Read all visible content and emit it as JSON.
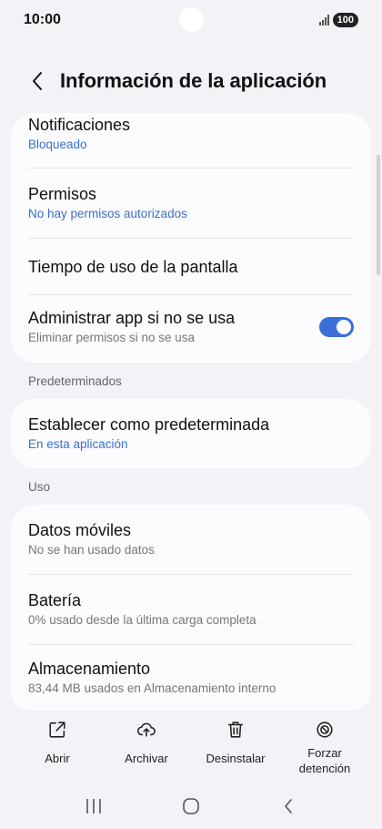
{
  "status": {
    "time": "10:00",
    "battery": "100"
  },
  "header": {
    "title": "Información de la aplicación"
  },
  "card1": {
    "items": [
      {
        "title": "Notificaciones",
        "sub": "Bloqueado"
      },
      {
        "title": "Permisos",
        "sub": "No hay permisos autorizados"
      },
      {
        "title": "Tiempo de uso de la pantalla"
      },
      {
        "title": "Administrar app si no se usa",
        "sub": "Eliminar permisos si no se usa",
        "toggle_on": true
      }
    ]
  },
  "section_defaults": {
    "label": "Predeterminados"
  },
  "card2": {
    "items": [
      {
        "title": "Establecer como predeterminada",
        "sub": "En esta aplicación"
      }
    ]
  },
  "section_usage": {
    "label": "Uso"
  },
  "card3": {
    "items": [
      {
        "title": "Datos móviles",
        "sub": "No se han usado datos"
      },
      {
        "title": "Batería",
        "sub": "0% usado desde la última carga completa"
      },
      {
        "title": "Almacenamiento",
        "sub": "83,44 MB usados en Almacenamiento interno"
      }
    ]
  },
  "actions": [
    {
      "label": "Abrir",
      "icon": "open-external-icon"
    },
    {
      "label": "Archivar",
      "icon": "cloud-upload-icon"
    },
    {
      "label": "Desinstalar",
      "icon": "trash-icon"
    },
    {
      "label": "Forzar detención",
      "icon": "block-icon"
    }
  ],
  "colors": {
    "accent": "#3a6fd9",
    "link": "#3a6fc9",
    "background": "#f2f2f7",
    "card": "#fcfcff"
  }
}
